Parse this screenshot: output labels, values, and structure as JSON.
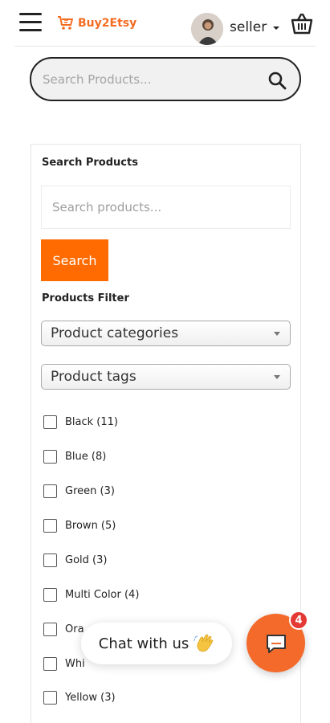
{
  "header": {
    "logo_text": "Buy2Etsy",
    "user_name": "seller",
    "brand_color": "#f36c21"
  },
  "top_search": {
    "placeholder": "Search Products..."
  },
  "widget": {
    "search_title": "Search Products",
    "search_placeholder": "Search products...",
    "search_button": "Search",
    "filter_title": "Products Filter",
    "categories_label": "Product categories",
    "tags_label": "Product tags",
    "filters": [
      {
        "label": "Black (11)"
      },
      {
        "label": "Blue (8)"
      },
      {
        "label": "Green (3)"
      },
      {
        "label": "Brown (5)"
      },
      {
        "label": "Gold (3)"
      },
      {
        "label": "Multi Color (4)"
      },
      {
        "label": "Ora"
      },
      {
        "label": "Whi"
      },
      {
        "label": "Yellow (3)"
      }
    ]
  },
  "chat": {
    "label": "Chat with us",
    "badge_count": "4",
    "accent": "#f36a2a"
  }
}
